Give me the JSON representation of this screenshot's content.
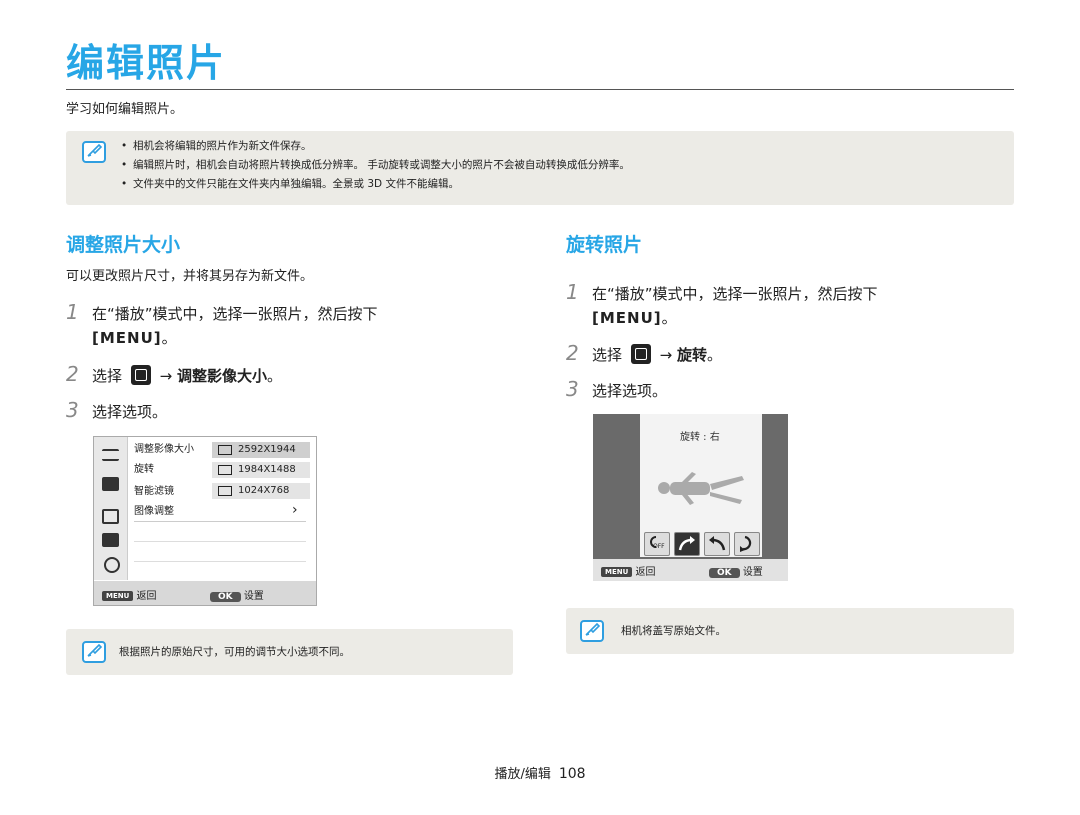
{
  "header": {
    "title": "编辑照片",
    "subtitle": "学习如何编辑照片。"
  },
  "top_note": {
    "items": [
      "相机会将编辑的照片作为新文件保存。",
      "编辑照片时，相机会自动将照片转换成低分辨率。 手动旋转或调整大小的照片不会被自动转换成低分辨率。",
      "文件夹中的文件只能在文件夹内单独编辑。全景或 3D 文件不能编辑。"
    ]
  },
  "resize": {
    "heading": "调整照片大小",
    "desc": "可以更改照片尺寸，并将其另存为新文件。",
    "step1_num": "1",
    "step1_text": "在“播放”模式中，选择一张照片，然后按下",
    "step1_key": "[MENU]",
    "step1_end": "。",
    "step2_num": "2",
    "step2_pre": "选择",
    "step2_arrow": "→",
    "step2_target": "调整影像大小",
    "step2_end": "。",
    "step3_num": "3",
    "step3_text": "选择选项。",
    "screen": {
      "menu_items": [
        "调整影像大小",
        "旋转",
        "智能滤镜",
        "图像调整"
      ],
      "sizes": [
        "2592X1944",
        "1984X1488",
        "1024X768"
      ],
      "submenu_arrow": "›",
      "menu_key": "MENU",
      "back_label": "返回",
      "ok_key": "OK",
      "set_label": "设置"
    },
    "note": "根据照片的原始尺寸，可用的调节大小选项不同。"
  },
  "rotate": {
    "heading": "旋转照片",
    "step1_num": "1",
    "step1_text": "在“播放”模式中，选择一张照片，然后按下",
    "step1_key": "[MENU]",
    "step1_end": "。",
    "step2_num": "2",
    "step2_pre": "选择",
    "step2_arrow": "→",
    "step2_target": "旋转",
    "step2_end": "。",
    "step3_num": "3",
    "step3_text": "选择选项。",
    "screen": {
      "label": "旋转 : 右",
      "off_label": "OFF",
      "menu_key": "MENU",
      "back_label": "返回",
      "ok_key": "OK",
      "set_label": "设置"
    },
    "note": "相机将盖写原始文件。"
  },
  "footer": {
    "section": "播放/编辑",
    "page": "108"
  },
  "colors": {
    "accent": "#27a6e6",
    "note_bg": "#ecebe6"
  }
}
